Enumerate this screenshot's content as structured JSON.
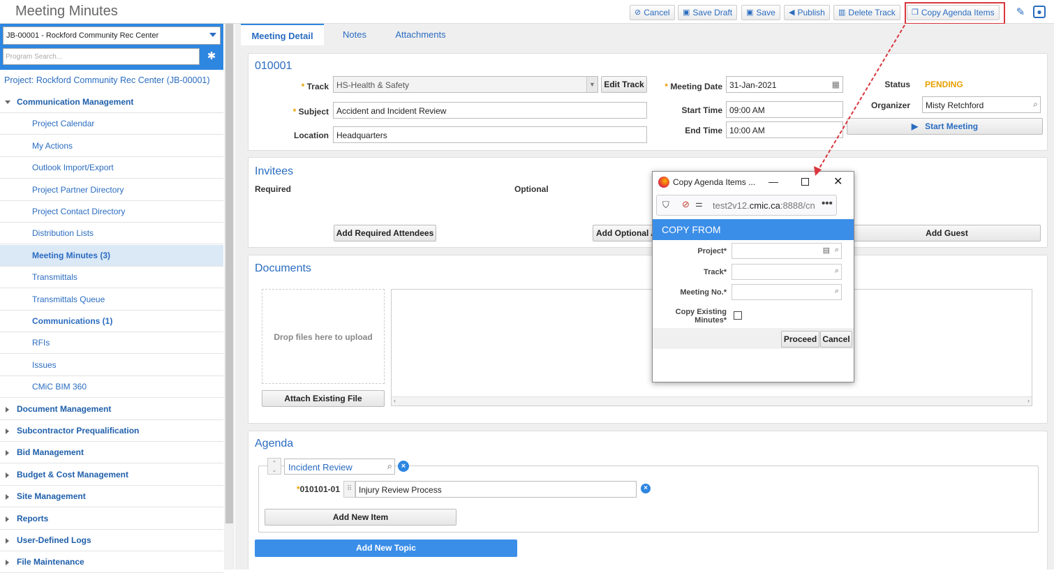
{
  "header": {
    "title": "Meeting Minutes",
    "buttons": {
      "cancel": "Cancel",
      "save_draft": "Save Draft",
      "save": "Save",
      "publish": "Publish",
      "delete_track": "Delete Track",
      "copy_agenda": "Copy Agenda Items"
    }
  },
  "sidebar": {
    "project_select": "JB-00001 - Rockford Community Rec Center",
    "search_placeholder": "Program Search...",
    "project_link": "Project: Rockford Community Rec Center (JB-00001)",
    "items": [
      {
        "label": "Communication Management",
        "kind": "group-open"
      },
      {
        "label": "Project Calendar",
        "kind": "child"
      },
      {
        "label": "My Actions",
        "kind": "child"
      },
      {
        "label": "Outlook Import/Export",
        "kind": "child"
      },
      {
        "label": "Project Partner Directory",
        "kind": "child"
      },
      {
        "label": "Project Contact Directory",
        "kind": "child"
      },
      {
        "label": "Distribution Lists",
        "kind": "child"
      },
      {
        "label": "Meeting Minutes (3)",
        "kind": "child-active"
      },
      {
        "label": "Transmittals",
        "kind": "child"
      },
      {
        "label": "Transmittals Queue",
        "kind": "child"
      },
      {
        "label": "Communications (1)",
        "kind": "child-bold"
      },
      {
        "label": "RFIs",
        "kind": "child"
      },
      {
        "label": "Issues",
        "kind": "child"
      },
      {
        "label": "CMiC BIM 360",
        "kind": "child"
      },
      {
        "label": "Document Management",
        "kind": "group"
      },
      {
        "label": "Subcontractor Prequalification",
        "kind": "group"
      },
      {
        "label": "Bid Management",
        "kind": "group"
      },
      {
        "label": "Budget & Cost Management",
        "kind": "group"
      },
      {
        "label": "Site Management",
        "kind": "group"
      },
      {
        "label": "Reports",
        "kind": "group"
      },
      {
        "label": "User-Defined Logs",
        "kind": "group"
      },
      {
        "label": "File Maintenance",
        "kind": "group"
      }
    ]
  },
  "tabs": [
    "Meeting Detail",
    "Notes",
    "Attachments"
  ],
  "meeting": {
    "number": "010001",
    "track_label": "Track",
    "track_value": "HS-Health & Safety",
    "edit_track": "Edit Track",
    "subject_label": "Subject",
    "subject_value": "Accident and Incident Review",
    "location_label": "Location",
    "location_value": "Headquarters",
    "date_label": "Meeting Date",
    "date_value": "31-Jan-2021",
    "start_label": "Start Time",
    "start_value": "09:00 AM",
    "end_label": "End Time",
    "end_value": "10:00 AM",
    "status_label": "Status",
    "status_value": "PENDING",
    "organizer_label": "Organizer",
    "organizer_value": "Misty Retchford",
    "start_meeting": "Start Meeting"
  },
  "invitees": {
    "title": "Invitees",
    "required": "Required",
    "optional": "Optional",
    "add_required": "Add Required Attendees",
    "add_optional": "Add Optional A",
    "add_guest": "Add Guest"
  },
  "documents": {
    "title": "Documents",
    "drop": "Drop files here to upload",
    "attach": "Attach Existing File"
  },
  "agenda": {
    "title": "Agenda",
    "topic": "Incident Review",
    "item_no": "010101-01",
    "item_value": "Injury Review Process",
    "add_item": "Add New Item",
    "add_topic": "Add New Topic"
  },
  "popup": {
    "window_title": "Copy Agenda Items ...",
    "url_host": "test2v12.",
    "url_domain": "cmic.ca",
    "url_rest": ":8888/cn",
    "header": "COPY FROM",
    "project_label": "Project*",
    "track_label": "Track*",
    "meeting_label": "Meeting No.*",
    "copy_minutes_line1": "Copy Existing",
    "copy_minutes_line2": "Minutes*",
    "proceed": "Proceed",
    "cancel": "Cancel"
  },
  "colors": {
    "accent": "#2d86e0",
    "link": "#2a6cc0",
    "status_pending": "#e8a000",
    "highlight": "#d9363e"
  }
}
